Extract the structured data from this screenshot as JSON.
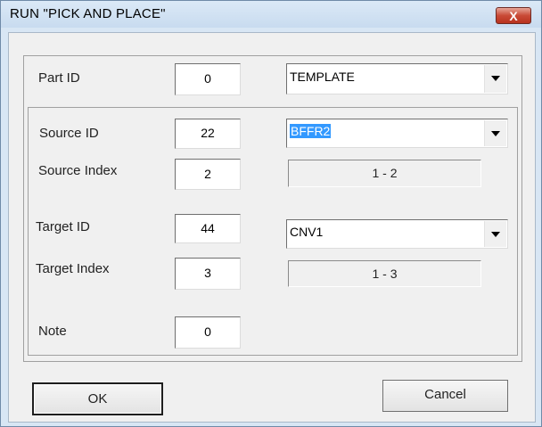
{
  "window": {
    "title": "RUN \"PICK AND PLACE\"",
    "close_glyph": "X"
  },
  "part": {
    "label": "Part ID",
    "value": "0",
    "combo_value": "TEMPLATE"
  },
  "source": {
    "id_label": "Source ID",
    "id_value": "22",
    "combo_value": "BFFR2",
    "index_label": "Source Index",
    "index_value": "2",
    "range": "1 - 2"
  },
  "target": {
    "id_label": "Target ID",
    "id_value": "44",
    "combo_value": "CNV1",
    "index_label": "Target Index",
    "index_value": "3",
    "range": "1 - 3"
  },
  "note": {
    "label": "Note",
    "value": "0"
  },
  "buttons": {
    "ok": "OK",
    "cancel": "Cancel"
  },
  "colors": {
    "close_red": "#c94a36",
    "selection": "#3399ff",
    "title_bg": "#d8e6f4"
  }
}
